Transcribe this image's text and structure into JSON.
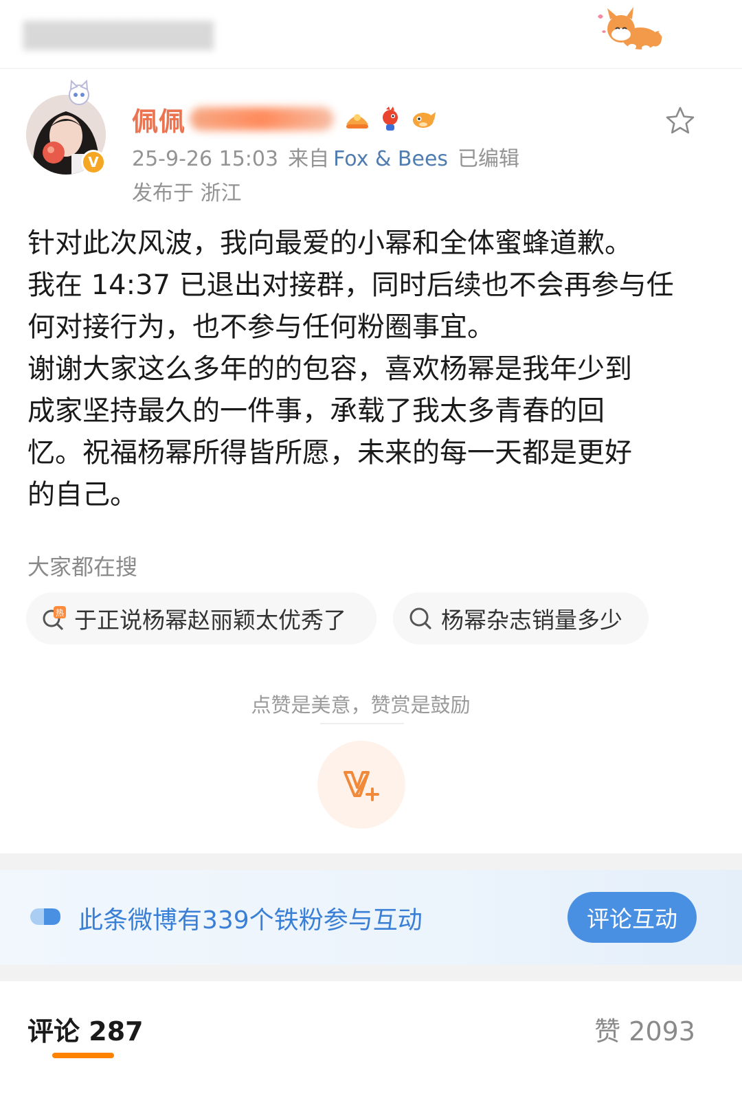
{
  "header": {
    "title": "",
    "sticker": "fox-sticker"
  },
  "post": {
    "username": "佩佩",
    "verified_badge": "V",
    "timestamp": "25-9-26 15:03",
    "source_prefix": "来自",
    "source": "Fox & Bees",
    "edited": "已编辑",
    "location": "发布于 浙江",
    "body_lines": [
      "针对此次风波，我向最爱的小幂和全体蜜蜂道歉。",
      "我在 14:37 已退出对接群，同时后续也不会再参与任",
      "何对接行为，也不参与任何粉圈事宜。",
      "谢谢大家这么多年的的包容，喜欢杨幂是我年少到",
      "成家坚持最久的一件事，承载了我太多青春的回",
      "忆。祝福杨幂所得皆所愿，未来的每一天都是更好",
      "的自己。"
    ]
  },
  "search": {
    "heading": "大家都在搜",
    "chips": [
      {
        "label": "于正说杨幂赵丽颖太优秀了",
        "icon": "hot-search-icon"
      },
      {
        "label": "杨幂杂志销量多少",
        "icon": "search-icon"
      }
    ]
  },
  "reward": {
    "text": "点赞是美意，赞赏是鼓励",
    "icon": "reward-v-plus-icon"
  },
  "fans": {
    "text": "此条微博有339个铁粉参与互动",
    "button": "评论互动"
  },
  "tabs": {
    "comments_label": "评论",
    "comments_count": "287",
    "likes_label": "赞",
    "likes_count": "2093"
  },
  "colors": {
    "username": "#eb7350",
    "source_link": "#507daf",
    "fans_blue": "#4a90e2",
    "tab_accent": "#ff8200"
  }
}
